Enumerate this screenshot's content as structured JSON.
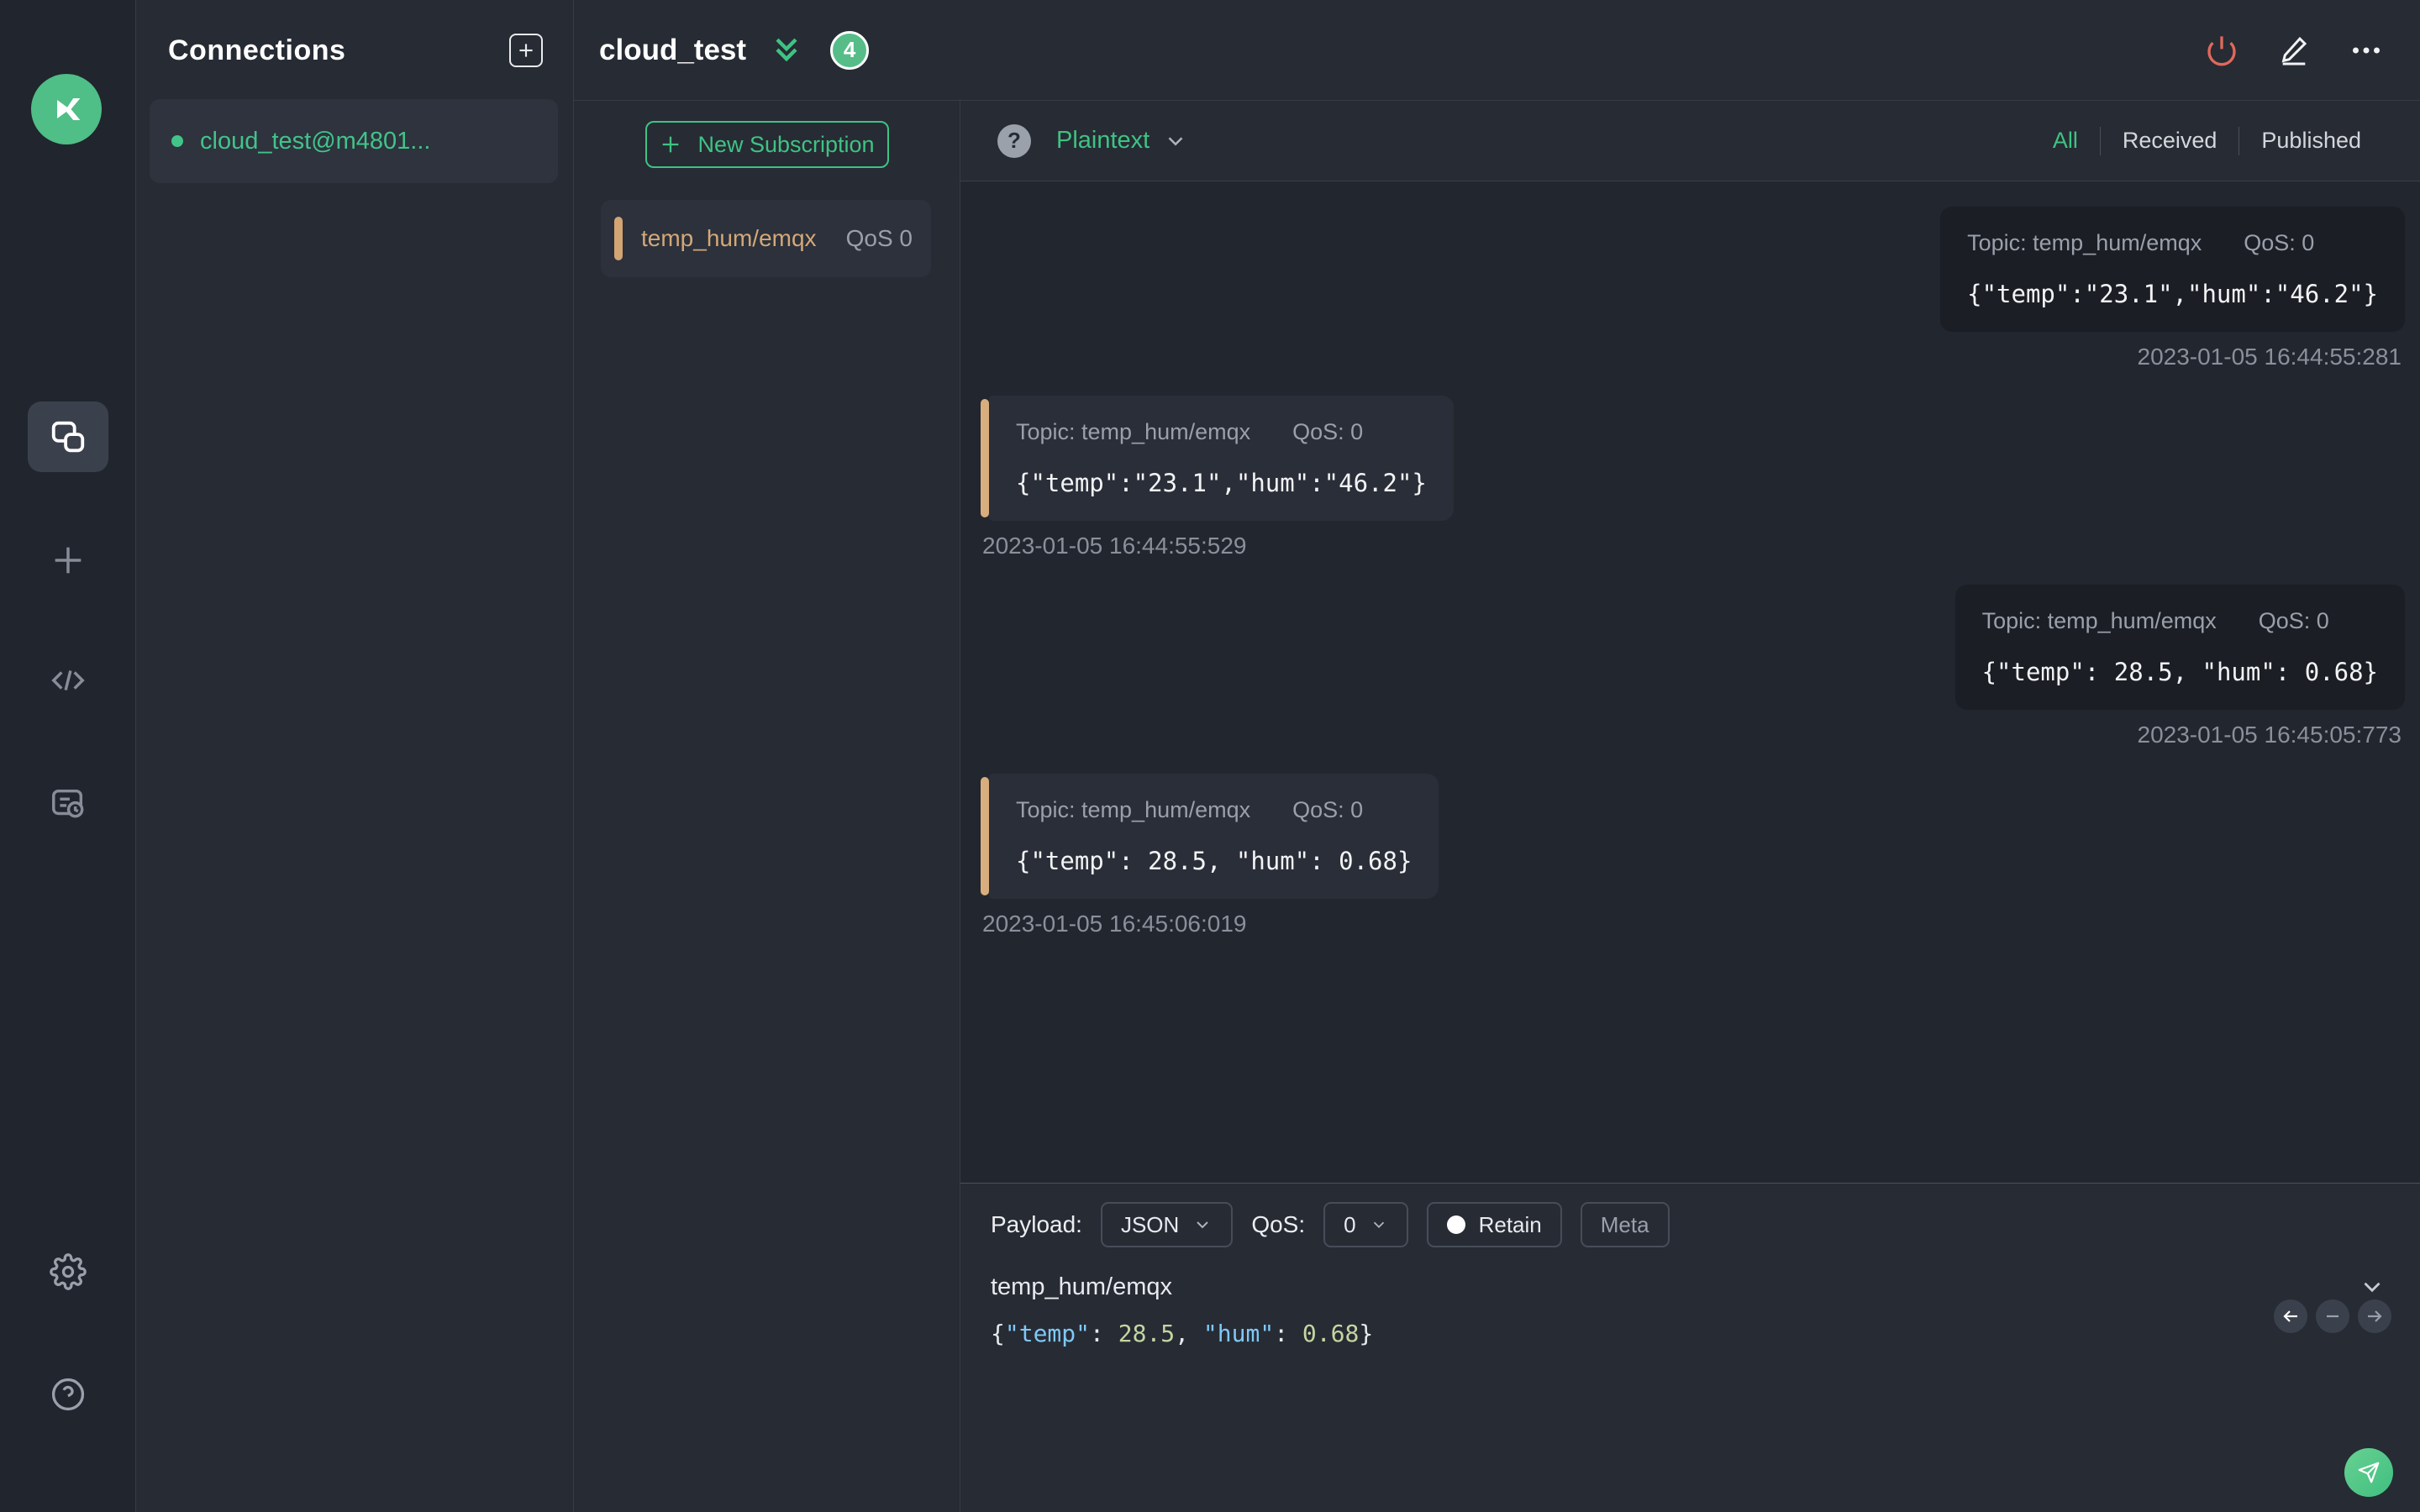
{
  "colors": {
    "accent_green": "#3ec383",
    "danger_red": "#e0695b",
    "topic_tan": "#d3a878",
    "badge_green": "#57bd88"
  },
  "connections": {
    "title": "Connections",
    "items": [
      {
        "label": "cloud_test@m4801...",
        "status": "connected"
      }
    ]
  },
  "header": {
    "title": "cloud_test",
    "unread_badge": "4"
  },
  "subscriptions": {
    "new_button_label": "New Subscription",
    "items": [
      {
        "topic": "temp_hum/emqx",
        "qos": "QoS 0"
      }
    ]
  },
  "messages": {
    "format": "Plaintext",
    "help_glyph": "?",
    "filters": {
      "all": "All",
      "received": "Received",
      "published": "Published",
      "active": "All"
    },
    "items": [
      {
        "type": "published",
        "topic": "Topic: temp_hum/emqx",
        "qos": "QoS: 0",
        "payload": "{\"temp\":\"23.1\",\"hum\":\"46.2\"}",
        "time": "2023-01-05 16:44:55:281"
      },
      {
        "type": "received",
        "topic": "Topic: temp_hum/emqx",
        "qos": "QoS: 0",
        "payload": "{\"temp\":\"23.1\",\"hum\":\"46.2\"}",
        "time": "2023-01-05 16:44:55:529"
      },
      {
        "type": "published",
        "topic": "Topic: temp_hum/emqx",
        "qos": "QoS: 0",
        "payload": "{\"temp\": 28.5, \"hum\": 0.68}",
        "time": "2023-01-05 16:45:05:773"
      },
      {
        "type": "received",
        "topic": "Topic: temp_hum/emqx",
        "qos": "QoS: 0",
        "payload": "{\"temp\": 28.5, \"hum\": 0.68}",
        "time": "2023-01-05 16:45:06:019"
      }
    ]
  },
  "publish": {
    "payload_label": "Payload:",
    "payload_format": "JSON",
    "qos_label": "QoS:",
    "qos_value": "0",
    "retain_label": "Retain",
    "meta_label": "Meta",
    "topic": "temp_hum/emqx",
    "code": {
      "t0": "{",
      "t1": "\"temp\"",
      "t2": ": ",
      "t3": "28.5",
      "t4": ", ",
      "t5": "\"hum\"",
      "t6": ": ",
      "t7": "0.68",
      "t8": "}"
    }
  }
}
